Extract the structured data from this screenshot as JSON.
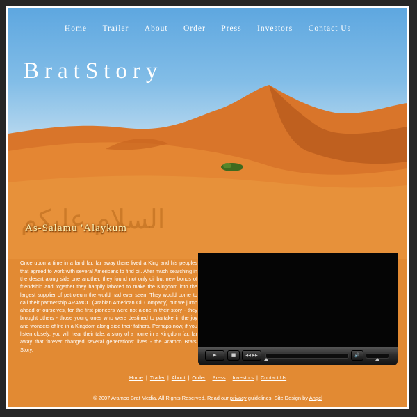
{
  "nav": {
    "items": [
      "Home",
      "Trailer",
      "About",
      "Order",
      "Press",
      "Investors",
      "Contact Us"
    ]
  },
  "brand": {
    "title": "BratStory"
  },
  "greeting": {
    "arabic": "السلام عليكم",
    "latin": "As-Salamu 'Alaykum"
  },
  "story": {
    "text": "Once upon a time in a land far, far away there lived a King and his peoples that agreed to work with several Americans to find oil.  After much searching in the desert along side one another, they found not only oil but new bonds of friendship and together they happily labored to make the Kingdom into the largest supplier of petroleum the world had ever seen.  They would come to call their partnership ARAMCO (Arabian American Oil Company) but we jump ahead of ourselves, for the first pioneers were not alone in their story - they brought others - those young ones who were destined to partake in the joy and wonders of life in a Kingdom along side their fathers.  Perhaps now, if you listen closely, you will hear their tale, a story of a home in a Kingdom far, far away that forever changed several generations' lives - the Aramco Brats' Story."
  },
  "player": {
    "buttons": {
      "play": "▶",
      "stop": "■",
      "prev": "◀◀",
      "next": "▶▶",
      "volume": "🔊"
    },
    "progress": 0.0,
    "volume_level": 0.5
  },
  "footer": {
    "links": [
      "Home",
      "Trailer",
      "About",
      "Order",
      "Press",
      "Investors",
      "Contact Us"
    ],
    "copyright_pre": "© 2007 Aramco Brat Media. All Rights Reserved. Read our ",
    "privacy_link": "privacy",
    "copyright_mid": " guidelines. Site Design by ",
    "designer_link": "Angel"
  },
  "colors": {
    "background": "#262626",
    "sand": "#e28a33",
    "sky": "#82bde7",
    "frame": "#ffffff"
  }
}
